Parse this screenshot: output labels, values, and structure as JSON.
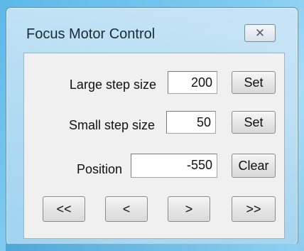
{
  "window": {
    "title": "Focus Motor Control",
    "close_symbol": "✕"
  },
  "large_step": {
    "label": "Large step size",
    "value": "200",
    "button": "Set"
  },
  "small_step": {
    "label": "Small step size",
    "value": "50",
    "button": "Set"
  },
  "position": {
    "label": "Position",
    "value": "-550",
    "button": "Clear"
  },
  "nav": {
    "large_back": "<<",
    "small_back": "<",
    "small_forward": ">",
    "large_forward": ">>"
  },
  "colors": {
    "desktop": "#7fcaf0",
    "client_bg": "#f0f0f0"
  }
}
